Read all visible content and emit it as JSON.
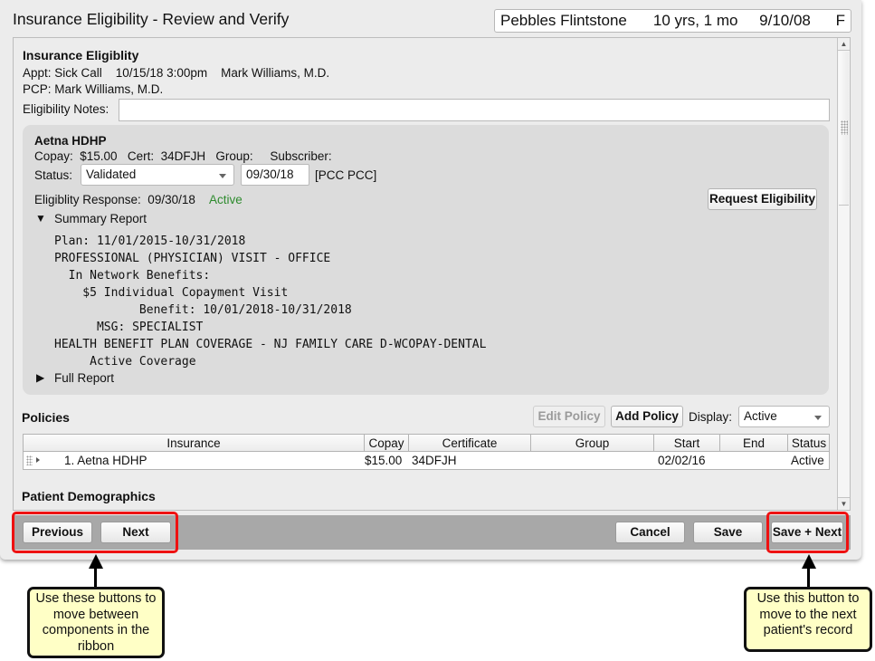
{
  "window": {
    "title": "Insurance Eligibility - Review and Verify"
  },
  "patient": {
    "name": "Pebbles Flintstone",
    "age": "10 yrs, 1 mo",
    "dob": "9/10/08",
    "sex": "F"
  },
  "eligibility": {
    "heading": "Insurance Eligiblity",
    "appt_line": "Appt: Sick Call    10/15/18 3:00pm    Mark Williams, M.D.",
    "pcp_line": "PCP: Mark Williams, M.D.",
    "notes_label": "Eligibility Notes:",
    "notes_value": "",
    "notes_placeholder": ""
  },
  "insurance_card": {
    "name": "Aetna HDHP",
    "details_line": "Copay:  $15.00   Cert:  34DFJH   Group:     Subscriber:",
    "status_label": "Status:",
    "status_value": "Validated",
    "status_date": "09/30/18",
    "status_user": "[PCC PCC]",
    "response_label": "Eligiblity Response:  09/30/18",
    "response_status": "Active",
    "response_status_color": "#2e8b2e",
    "request_button": "Request Eligibility",
    "summary_toggle_icon": "triangle-down",
    "summary_label": "Summary Report",
    "summary_lines": [
      "Plan: 11/01/2015-10/31/2018",
      "PROFESSIONAL (PHYSICIAN) VISIT - OFFICE",
      "  In Network Benefits:",
      "    $5 Individual Copayment Visit",
      "            Benefit: 10/01/2018-10/31/2018",
      "      MSG: SPECIALIST",
      "HEALTH BENEFIT PLAN COVERAGE - NJ FAMILY CARE D-WCOPAY-DENTAL",
      "     Active Coverage"
    ],
    "full_report_toggle_icon": "triangle-right",
    "full_report_label": "Full Report"
  },
  "policies": {
    "heading": "Policies",
    "edit_button": "Edit Policy",
    "add_button": "Add Policy",
    "display_label": "Display:",
    "display_value": "Active",
    "columns": [
      "Insurance",
      "Copay",
      "Certificate",
      "Group",
      "Start",
      "End",
      "Status"
    ],
    "rows": [
      {
        "insurance": "1. Aetna HDHP",
        "copay": "$15.00",
        "certificate": "34DFJH",
        "group": "",
        "start": "02/02/16",
        "end": "",
        "status": "Active"
      }
    ]
  },
  "demographics": {
    "heading": "Patient Demographics"
  },
  "footer": {
    "previous": "Previous",
    "next": "Next",
    "cancel": "Cancel",
    "save": "Save",
    "save_next": "Save + Next"
  },
  "annotations": {
    "left_callout": "Use these buttons to move between components in the ribbon",
    "right_callout": "Use this button to move to the next patient's record",
    "highlight_color": "#ee1111",
    "callout_color": "#ffffc6"
  }
}
